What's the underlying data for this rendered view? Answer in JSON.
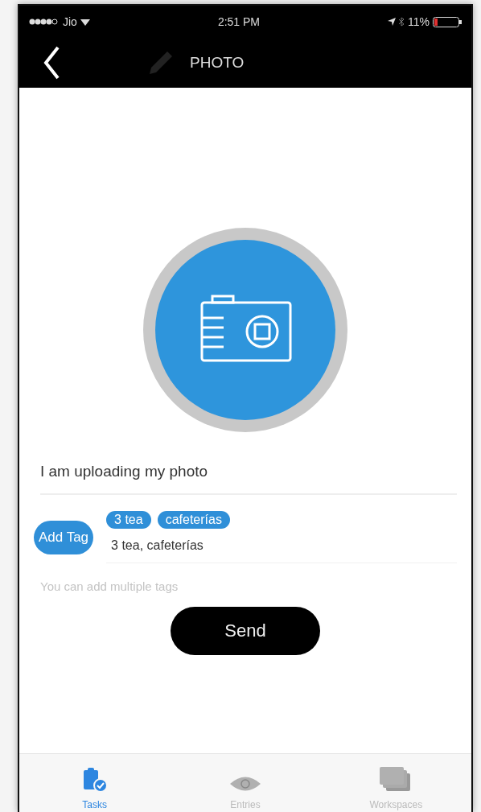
{
  "status_bar": {
    "carrier": "Jio",
    "time": "2:51 PM",
    "battery": "11%"
  },
  "nav_bar": {
    "title": "PHOTO"
  },
  "caption": {
    "value": "I am uploading my photo"
  },
  "tags": {
    "button": "Add Tag",
    "chips": [
      "3 tea",
      "cafeterías"
    ],
    "value": "3 tea, cafeterías",
    "hint": "You can add multiple tags"
  },
  "send_button": "Send",
  "tab_bar": [
    {
      "label": "Tasks",
      "selected": true,
      "kind": "tasks"
    },
    {
      "label": "Entries",
      "selected": false,
      "kind": "entries"
    },
    {
      "label": "Workspaces",
      "selected": false,
      "kind": "workspaces"
    }
  ]
}
